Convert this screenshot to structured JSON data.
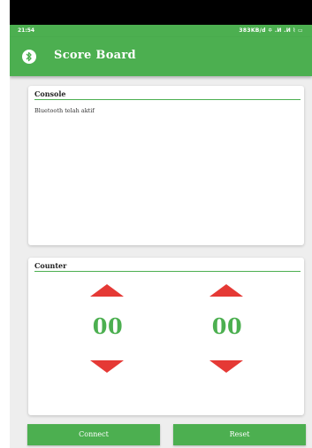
{
  "status_bar": {
    "time": "21:54",
    "indicators": "383KB/d ✡ .ⵍ .ⵍ ⌇ ▭"
  },
  "app_bar": {
    "title": "Score Board",
    "icon": "bluetooth-icon",
    "color": "#4caf50"
  },
  "console": {
    "title": "Console",
    "message": "Bluetooth telah aktif"
  },
  "counter": {
    "title": "Counter",
    "left_score": "00",
    "right_score": "00",
    "up_icon": "arrow-up-icon",
    "down_icon": "arrow-down-icon",
    "arrow_color": "#e53935"
  },
  "buttons": {
    "connect_label": "Connect",
    "reset_label": "Reset"
  }
}
